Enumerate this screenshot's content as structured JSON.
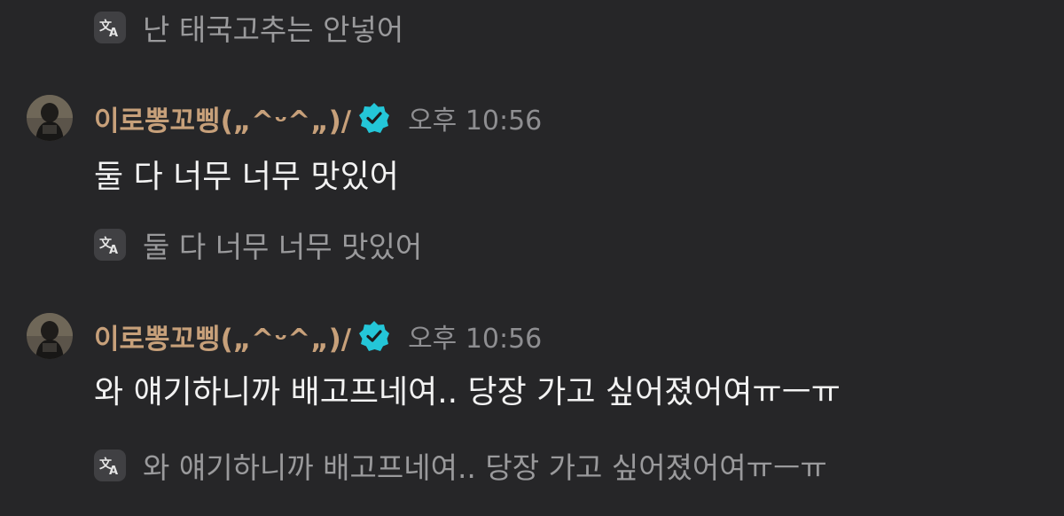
{
  "colors": {
    "background": "#262628",
    "sender_name": "#c7a07a",
    "message_text": "#f2f2f2",
    "translation_text": "#9a9a9c",
    "timestamp": "#8e8e91",
    "verified_badge": "#24c6d8"
  },
  "icons": {
    "translate": "translate-icon",
    "verified": "verified-badge-icon",
    "avatar": "avatar"
  },
  "messages": [
    {
      "translation": "난 태국고추는 안넣어"
    },
    {
      "sender": "이로뽕꼬삥(„^ᵕ^„)/",
      "time": "오후 10:56",
      "text": "둘 다 너무 너무 맛있어",
      "translation": "둘 다 너무 너무 맛있어"
    },
    {
      "sender": "이로뽕꼬삥(„^ᵕ^„)/",
      "time": "오후 10:56",
      "text": "와 얘기하니까 배고프네여.. 당장 가고 싶어졌어여ㅠㅡㅠ",
      "translation": "와 얘기하니까 배고프네여.. 당장 가고 싶어졌어여ㅠㅡㅠ"
    }
  ]
}
